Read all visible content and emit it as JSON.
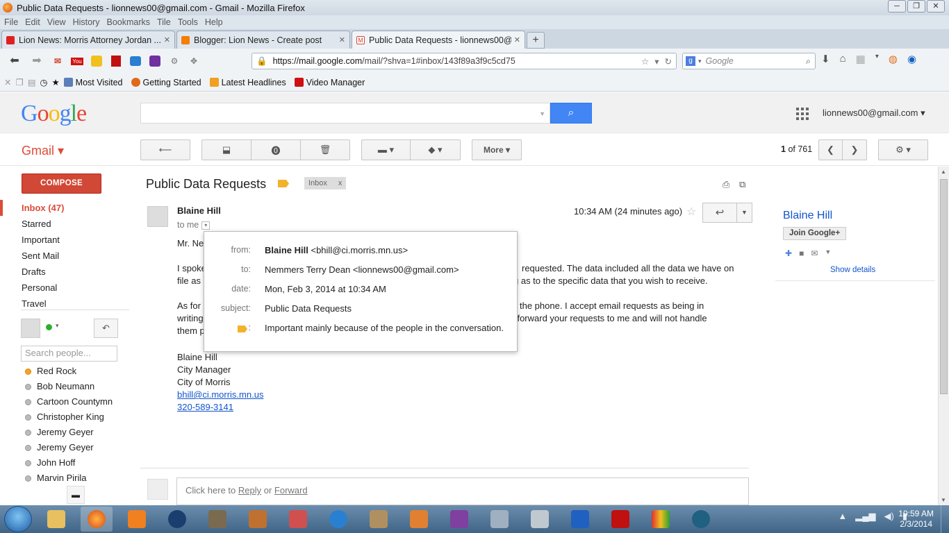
{
  "window": {
    "title": "Public Data Requests - lionnews00@gmail.com - Gmail - Mozilla Firefox",
    "controls": [
      "─",
      "❐",
      "✕"
    ]
  },
  "menu": [
    "File",
    "Edit",
    "View",
    "History",
    "Bookmarks",
    "Tile",
    "Tools",
    "Help"
  ],
  "tabs": [
    {
      "label": "Lion News: Morris Attorney Jordan ...",
      "color": "#e02020"
    },
    {
      "label": "Blogger: Lion News - Create post",
      "color": "#f57d00"
    },
    {
      "label": "Public Data Requests - lionnews00@g...",
      "color": "#d14836"
    }
  ],
  "newtab": "+",
  "url": {
    "host": "https://mail.google.com",
    "path": "/mail/?shva=1#inbox/143f89a3f9c5cd75"
  },
  "search_engine_placeholder": "Google",
  "bookmarks": [
    {
      "label": "Most Visited",
      "color": "#5b7fb8"
    },
    {
      "label": "Getting Started",
      "color": "#e06a1b"
    },
    {
      "label": "Latest Headlines",
      "color": "#f0a020"
    },
    {
      "label": "Video Manager",
      "color": "#d01010"
    }
  ],
  "google": {
    "logo": "Google",
    "logo_colors": [
      "#4285f4",
      "#ea4335",
      "#fbbc05",
      "#4285f4",
      "#34a853",
      "#ea4335"
    ],
    "account": "lionnews00@gmail.com ▾"
  },
  "gmail": {
    "label": "Gmail ▾",
    "more": "More ▾",
    "paging": {
      "current": "1",
      "of": "of 761"
    },
    "compose": "COMPOSE",
    "nav": [
      {
        "label": "Inbox (47)",
        "selected": true
      },
      {
        "label": "Starred"
      },
      {
        "label": "Important"
      },
      {
        "label": "Sent Mail"
      },
      {
        "label": "Drafts"
      },
      {
        "label": "Personal"
      },
      {
        "label": "Travel"
      }
    ],
    "people_search_placeholder": "Search people...",
    "contacts": [
      {
        "name": "Red Rock",
        "online": true
      },
      {
        "name": "Bob Neumann"
      },
      {
        "name": "Cartoon Countymn"
      },
      {
        "name": "Christopher King"
      },
      {
        "name": "Jeremy Geyer"
      },
      {
        "name": "Jeremy Geyer"
      },
      {
        "name": "John Hoff"
      },
      {
        "name": "Marvin Pirila"
      }
    ]
  },
  "thread": {
    "subject": "Public Data Requests",
    "chip": "Inbox",
    "chip_close": "x",
    "sender": "Blaine Hill",
    "to": "to me",
    "time": "10:34 AM (24 minutes ago)",
    "body": [
      "Mr. Ne",
      "I spoke requested.  The data included all the data we have on file as g as to the specific data that you wish to receive.",
      "As for the phone.  I accept email requests as being in writing to forward your requests to me and will not handle them p"
    ],
    "body_lines": {
      "p1a": "Mr. Ne",
      "p2a": "I spoke",
      "p2b": "requested.  The data included all the data we have on",
      "p2c": "file as",
      "p2d": "g as to the specific data that you wish to receive.",
      "p3a": "As for",
      "p3b": "the phone.  I accept email requests as being in",
      "p3c": "writing",
      "p3d": "to forward your requests to me and will not handle",
      "p3e": "them p"
    },
    "signature": [
      "Blaine Hill",
      "City Manager",
      "City of Morris"
    ],
    "sig_email": "bhill@ci.morris.mn.us",
    "sig_phone": "320-589-3141",
    "reply_prompt": {
      "pre": "Click here to ",
      "reply": "Reply",
      "mid": " or ",
      "forward": "Forward"
    }
  },
  "popup": {
    "from_label": "from:",
    "from_name": "Blaine Hill",
    "from_email": "<bhill@ci.morris.mn.us>",
    "to_label": "to:",
    "to_value": "Nemmers Terry Dean <lionnews00@gmail.com>",
    "date_label": "date:",
    "date_value": "Mon, Feb 3, 2014 at 10:34 AM",
    "subject_label": "subject:",
    "subject_value": "Public Data Requests",
    "importance_suffix": ":",
    "importance_value": "Important mainly because of the people in the conversation."
  },
  "contact_panel": {
    "name": "Blaine Hill",
    "join": "Join Google+",
    "show_details": "Show details"
  },
  "taskbar": {
    "time": "10:59 AM",
    "date": "2/3/2014"
  }
}
